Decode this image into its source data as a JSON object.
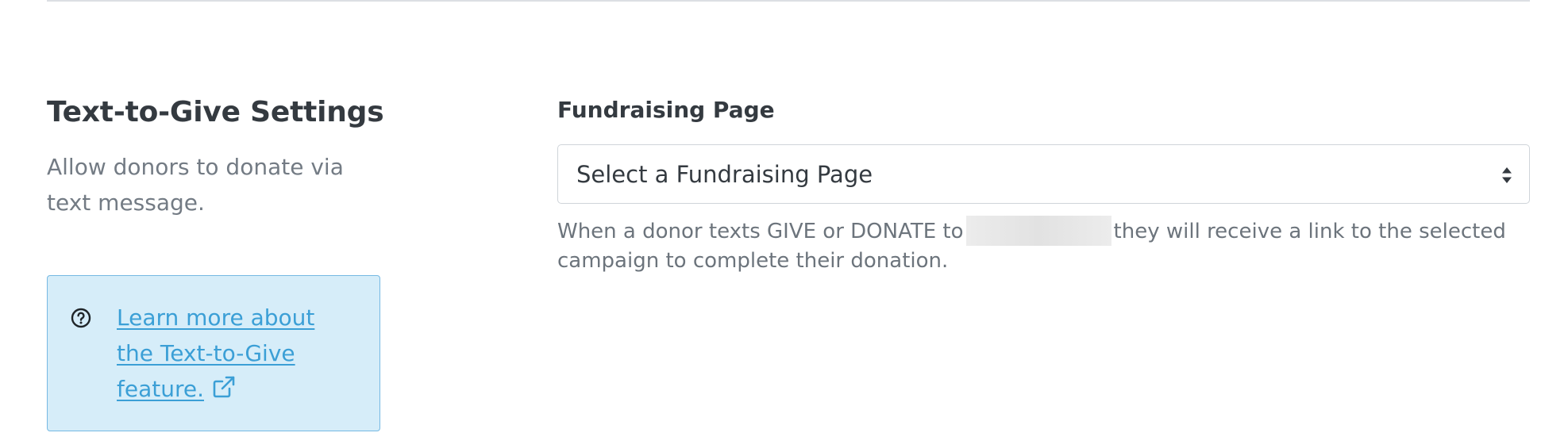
{
  "section": {
    "title": "Text-to-Give Settings",
    "description": "Allow donors to donate via text message."
  },
  "info_box": {
    "icon": "question-circle-icon",
    "link_text": "Learn more about the Text-to-Give feature.",
    "link_icon": "external-link-icon",
    "bg_color": "#d6edf9",
    "border_color": "#76b9e3",
    "link_color": "#3b9fd6"
  },
  "fundraising_page": {
    "label": "Fundraising Page",
    "select_value": "Select a Fundraising Page",
    "help_before": "When a donor texts GIVE or DONATE to",
    "help_after": "they will receive a link to the selected campaign to complete their donation."
  }
}
